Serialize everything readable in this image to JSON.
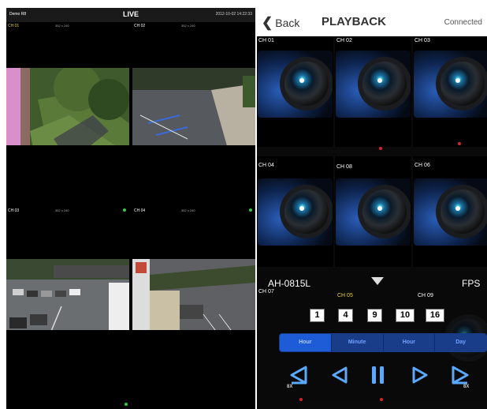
{
  "live": {
    "device": "Demo R8",
    "title": "LIVE",
    "timestamp": "2012-10-02 14:22:33",
    "cells": [
      {
        "label": "CH 01",
        "resolution": "352 x 240",
        "label_color": "#e8d23a"
      },
      {
        "label": "CH 02",
        "resolution": "352 x 240",
        "label_color": "#ffffff"
      },
      {
        "label": "CH 03",
        "resolution": "352 x 240",
        "label_color": "#ffffff"
      },
      {
        "label": "CH 04",
        "resolution": "352 x 240",
        "label_color": "#ffffff"
      },
      {
        "label": "",
        "resolution": "",
        "label_color": "#ffffff"
      },
      {
        "label": "",
        "resolution": "",
        "label_color": "#ffffff"
      }
    ]
  },
  "playback": {
    "back_label": "Back",
    "title": "PLAYBACK",
    "status": "Connected",
    "channels": [
      "CH 01",
      "CH 02",
      "CH 03",
      "CH 04",
      "CH 08",
      "CH 06"
    ],
    "bottom_channels": [
      "CH 07",
      "CH 05",
      "CH 09"
    ],
    "model": "AH-0815L",
    "fps_label": "FPS",
    "split_buttons": [
      "1",
      "4",
      "9",
      "10",
      "16"
    ],
    "speed_modes": [
      "Hour",
      "Minute",
      "Hour",
      "Day"
    ],
    "speed_marker": "8X"
  },
  "colors": {
    "accent": "#1d5cd6",
    "segment_bg": "#1a3d8a",
    "status_green": "#2ecc40",
    "record_red": "#dd2222",
    "selected_channel": "#e8d23a"
  },
  "icons": [
    "chevron-left-icon",
    "dropdown-triangle-icon",
    "fast-rewind-icon",
    "step-back-icon",
    "pause-icon",
    "step-forward-icon",
    "fast-forward-icon"
  ]
}
